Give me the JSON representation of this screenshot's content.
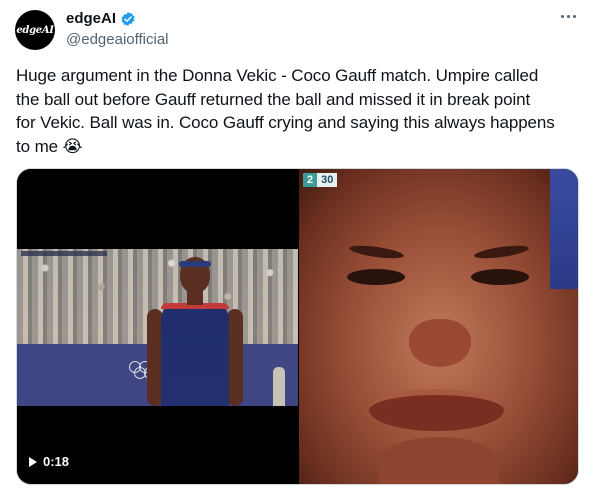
{
  "author": {
    "avatar_text": "edgeAI",
    "display_name": "edgeAI",
    "handle": "@edgeaiofficial",
    "verified_icon": "verified-badge-icon",
    "accent_color": "#1d9bf0"
  },
  "menu": {
    "more_icon": "more-horizontal-icon"
  },
  "tweet": {
    "lines": [
      "Huge argument in the Donna Vekic - Coco Gauff match. Umpire called",
      "the ball out before Gauff returned the ball and missed it  in break point",
      "for Vekic. Ball was in. Coco Gauff crying and saying this always happens",
      "to me 😭"
    ]
  },
  "media": {
    "left": {
      "duration": "0:18",
      "play_icon": "play-icon"
    },
    "right": {
      "score_a": "2",
      "score_b": "30"
    }
  }
}
